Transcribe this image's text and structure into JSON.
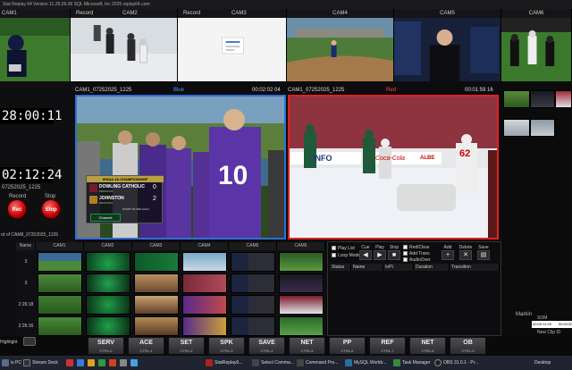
{
  "window": {
    "title": "Stat Replay 64 Version 11.25.06.06   SQL Microsoft, Inc 2025   replay64.com"
  },
  "cam_strip": [
    {
      "label": "CAM1",
      "align": "left"
    },
    {
      "label": "Record"
    },
    {
      "label": "CAM2"
    },
    {
      "label": "Record"
    },
    {
      "label": "CAM3"
    },
    {
      "label": "CAM4"
    },
    {
      "label": "CAM5"
    },
    {
      "label": "CAM6"
    }
  ],
  "left_panel": {
    "clock1": "28:00:11",
    "clock2": "02:12:24",
    "date": "07252025_1225",
    "record_label": "Record",
    "stop_label": "Stop",
    "record_button": "Rec",
    "stop_button": "Stop",
    "clip_path": "rd of CAM8_07252025_1225"
  },
  "preview_left": {
    "cam": "CAM1_07252025_1225",
    "label": "Blue",
    "time": "00:02:02 04"
  },
  "preview_right": {
    "cam": "CAM1_07252025_1225",
    "label": "Red",
    "time": "00:01:59 16"
  },
  "scorebug": {
    "title": "IHSAA 4A CHAMPIONSHIP",
    "team1": "DOWLING CATHOLIC",
    "team1_sub": "MAROONS",
    "score1": "0",
    "team2": "JOHNSTON",
    "team2_sub": "DRAGONS",
    "score2": "2",
    "period": "START OF 2ND HALF",
    "channel": "Channel"
  },
  "jersey_number": "10",
  "rink_ads": [
    "INFO",
    "Coca-Cola",
    "ALBE"
  ],
  "grid": {
    "headers": [
      "Name",
      "CAM1",
      "CAM2",
      "CAM3",
      "CAM4",
      "CAM5",
      "CAM6"
    ],
    "rows": [
      "3",
      "3",
      "2:26:18",
      "2:26:16"
    ]
  },
  "playlist": {
    "buttons": [
      {
        "label": "Cue",
        "icon": "◀"
      },
      {
        "label": "Play",
        "icon": "▶"
      },
      {
        "label": "Stop",
        "icon": "■"
      }
    ],
    "buttons2": [
      {
        "label": "Add",
        "icon": "+"
      },
      {
        "label": "Delete",
        "icon": "✕"
      },
      {
        "label": "Save",
        "icon": "▤"
      }
    ],
    "options": [
      "Play List",
      "Loop Mode"
    ],
    "options2": [
      "Red/Clear",
      "Add Trans",
      "AudioOver"
    ],
    "columns": [
      "Status",
      "Name",
      "InPt",
      "Duration",
      "Transition"
    ]
  },
  "right_panel": {
    "marker": "Markin",
    "som": "SOM",
    "tc1": "00:00:11:05",
    "tc2": "00:00:00",
    "new_clip": "New Clip ID"
  },
  "highlight_label": "Highlight",
  "fkeys": [
    {
      "key": "SERV",
      "sub": "CTRL-0"
    },
    {
      "key": "ACE",
      "sub": "CTRL-1"
    },
    {
      "key": "SET",
      "sub": "CTRL-2"
    },
    {
      "key": "SPK",
      "sub": "CTRL-3"
    },
    {
      "key": "SAVE",
      "sub": "CTRL-4"
    },
    {
      "key": "NET",
      "sub": "CTRL-5"
    },
    {
      "key": "PP",
      "sub": "CTRL-6"
    },
    {
      "key": "REF",
      "sub": "CTRL-7"
    },
    {
      "key": "NET",
      "sub": "CTRL-8"
    },
    {
      "key": "OB",
      "sub": "CTRL-9"
    }
  ],
  "taskbar": [
    {
      "label": "is PC",
      "color": "#5a6b8c"
    },
    {
      "label": "Stream Deck",
      "color": "#333"
    },
    {
      "label": "",
      "color": "#c33"
    },
    {
      "label": "",
      "color": "#3a7bd5"
    },
    {
      "label": "",
      "color": "#e0a020"
    },
    {
      "label": "",
      "color": "#2b9b3b"
    },
    {
      "label": "",
      "color": "#d04020"
    },
    {
      "label": "",
      "color": "#888"
    },
    {
      "label": "",
      "color": "#4aa0e0"
    },
    {
      "label": "StatReplay6...",
      "color": "#b02020"
    },
    {
      "label": "Select Comma...",
      "color": "#444"
    },
    {
      "label": "Command Pro...",
      "color": "#444"
    },
    {
      "label": "MySQL Workb...",
      "color": "#2a6fa0"
    },
    {
      "label": "Task Manager",
      "color": "#3a8a3a"
    },
    {
      "label": "OBS 31.0.1 - Pr...",
      "color": "#222"
    },
    {
      "label": "Desktop",
      "color": "#555"
    }
  ]
}
